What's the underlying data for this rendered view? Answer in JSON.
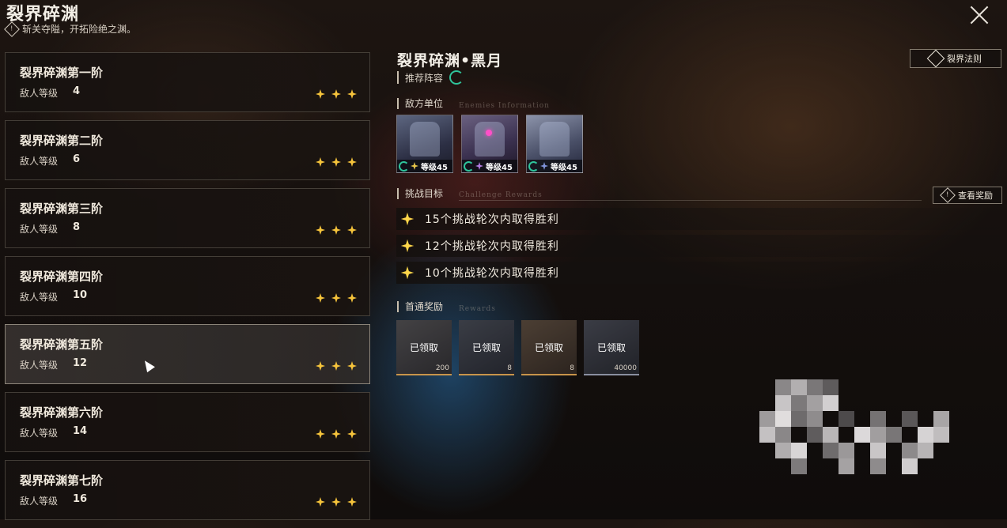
{
  "header": {
    "title": "裂界碎渊",
    "subtitle": "斩关夺隘，开拓险绝之渊。"
  },
  "stages": [
    {
      "name": "裂界碎渊第一阶",
      "level_label": "敌人等级",
      "level": "4",
      "stars": 3,
      "active": false
    },
    {
      "name": "裂界碎渊第二阶",
      "level_label": "敌人等级",
      "level": "6",
      "stars": 3,
      "active": false
    },
    {
      "name": "裂界碎渊第三阶",
      "level_label": "敌人等级",
      "level": "8",
      "stars": 3,
      "active": false
    },
    {
      "name": "裂界碎渊第四阶",
      "level_label": "敌人等级",
      "level": "10",
      "stars": 3,
      "active": false
    },
    {
      "name": "裂界碎渊第五阶",
      "level_label": "敌人等级",
      "level": "12",
      "stars": 3,
      "active": true
    },
    {
      "name": "裂界碎渊第六阶",
      "level_label": "敌人等级",
      "level": "14",
      "stars": 3,
      "active": false
    },
    {
      "name": "裂界碎渊第七阶",
      "level_label": "敌人等级",
      "level": "16",
      "stars": 3,
      "active": false
    }
  ],
  "detail": {
    "title": "裂界碎渊•黑月",
    "rules_button": "裂界法则",
    "recommend_label": "推荐阵容",
    "enemies_label": "敌方单位",
    "enemies_ghost": "Enemies Information",
    "enemies": [
      {
        "level_text": "等级45",
        "type_color": "gold"
      },
      {
        "level_text": "等级45",
        "type_color": "purple"
      },
      {
        "level_text": "等级45",
        "type_color": "blue"
      }
    ],
    "objectives_label": "挑战目标",
    "objectives_ghost": "Challenge Rewards",
    "view_rewards_button": "查看奖励",
    "objectives": [
      "15个挑战轮次内取得胜利",
      "12个挑战轮次内取得胜利",
      "10个挑战轮次内取得胜利"
    ],
    "first_clear_label": "首通奖励",
    "first_clear_ghost": "Rewards",
    "rewards": [
      {
        "status": "已领取",
        "qty": "200"
      },
      {
        "status": "已领取",
        "qty": "8"
      },
      {
        "status": "已领取",
        "qty": "8"
      },
      {
        "status": "已领取",
        "qty": "40000"
      }
    ]
  },
  "colors": {
    "star": "#f5c33b",
    "element_wind": "#2fc49b",
    "reward_border": "#c8944a"
  }
}
